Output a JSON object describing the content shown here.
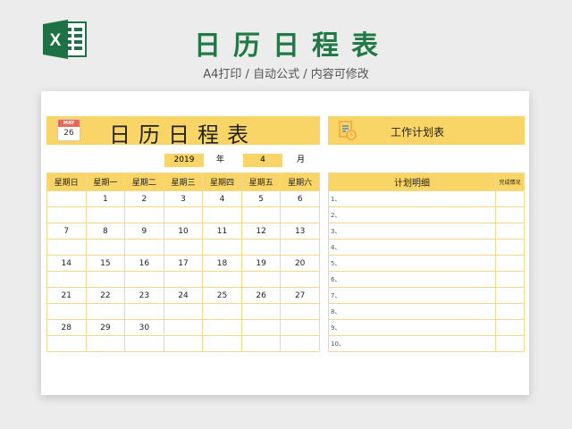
{
  "header": {
    "title": "日历日程表",
    "subtitle": "A4打印 / 自动公式 / 内容可修改"
  },
  "calendar": {
    "title": "日历日程表",
    "icon": {
      "month": "MAY",
      "day": "26"
    },
    "year": "2019",
    "year_label": "年",
    "month": "4",
    "month_label": "月",
    "weekdays": [
      "星期日",
      "星期一",
      "星期二",
      "星期三",
      "星期四",
      "星期五",
      "星期六"
    ],
    "weeks": [
      [
        "",
        "1",
        "2",
        "3",
        "4",
        "5",
        "6"
      ],
      [
        "7",
        "8",
        "9",
        "10",
        "11",
        "12",
        "13"
      ],
      [
        "14",
        "15",
        "16",
        "17",
        "18",
        "19",
        "20"
      ],
      [
        "21",
        "22",
        "23",
        "24",
        "25",
        "26",
        "27"
      ],
      [
        "28",
        "29",
        "30",
        "",
        "",
        "",
        ""
      ]
    ]
  },
  "plan": {
    "title": "工作计划表",
    "detail_header": "计划明细",
    "status_header": "完成情况",
    "rows": [
      "1、",
      "2、",
      "3、",
      "4、",
      "5、",
      "6、",
      "7、",
      "8、",
      "9、",
      "10、"
    ]
  },
  "colors": {
    "accent": "#f9d567",
    "title_green": "#1f7a45",
    "excel_green": "#1e7145"
  },
  "icons": {
    "logo": "excel-icon",
    "calendar": "calendar-icon",
    "plan": "document-clock-icon"
  }
}
